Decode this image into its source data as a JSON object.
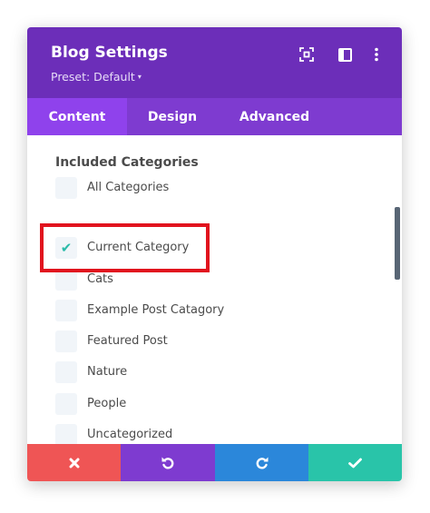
{
  "header": {
    "title": "Blog Settings",
    "preset": "Preset: Default",
    "preset_caret": "▾"
  },
  "tabs": [
    {
      "label": "Content",
      "active": true
    },
    {
      "label": "Design",
      "active": false
    },
    {
      "label": "Advanced",
      "active": false
    }
  ],
  "content": {
    "section_label": "Included Categories",
    "categories": [
      {
        "label": "All Categories",
        "checked": false
      },
      {
        "label": "Current Category",
        "checked": true
      },
      {
        "label": "Cats",
        "checked": false
      },
      {
        "label": "Example Post Catagory",
        "checked": false
      },
      {
        "label": "Featured Post",
        "checked": false
      },
      {
        "label": "Nature",
        "checked": false
      },
      {
        "label": "People",
        "checked": false
      },
      {
        "label": "Uncategorized",
        "checked": false
      }
    ],
    "check_glyph": "✔"
  },
  "colors": {
    "header_bg": "#6c2eb9",
    "tabs_bg": "#7e3bd0",
    "tab_active_bg": "#8f42ec",
    "check": "#2bbba9",
    "highlight": "#e1131e",
    "discard": "#ef5555",
    "undo": "#7e3bd0",
    "redo": "#2b87da",
    "save": "#29c4a9"
  },
  "icons": {
    "header": [
      "focus-target-icon",
      "split-view-icon",
      "more-vertical-icon"
    ],
    "footer": [
      "close-icon",
      "undo-icon",
      "redo-icon",
      "checkmark-icon"
    ]
  }
}
